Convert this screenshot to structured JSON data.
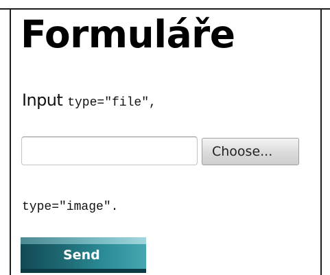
{
  "heading": "Formuláře",
  "intro": {
    "text": "Input ",
    "code": "type=\"file\"",
    "suffix": ","
  },
  "file_input": {
    "value": "",
    "button_label": "Choose..."
  },
  "image_input": {
    "code": "type=\"image\"",
    "suffix": "."
  },
  "send_button": {
    "label": "Send",
    "colors": {
      "dark": "#114a54",
      "light": "#46a7b1"
    }
  }
}
